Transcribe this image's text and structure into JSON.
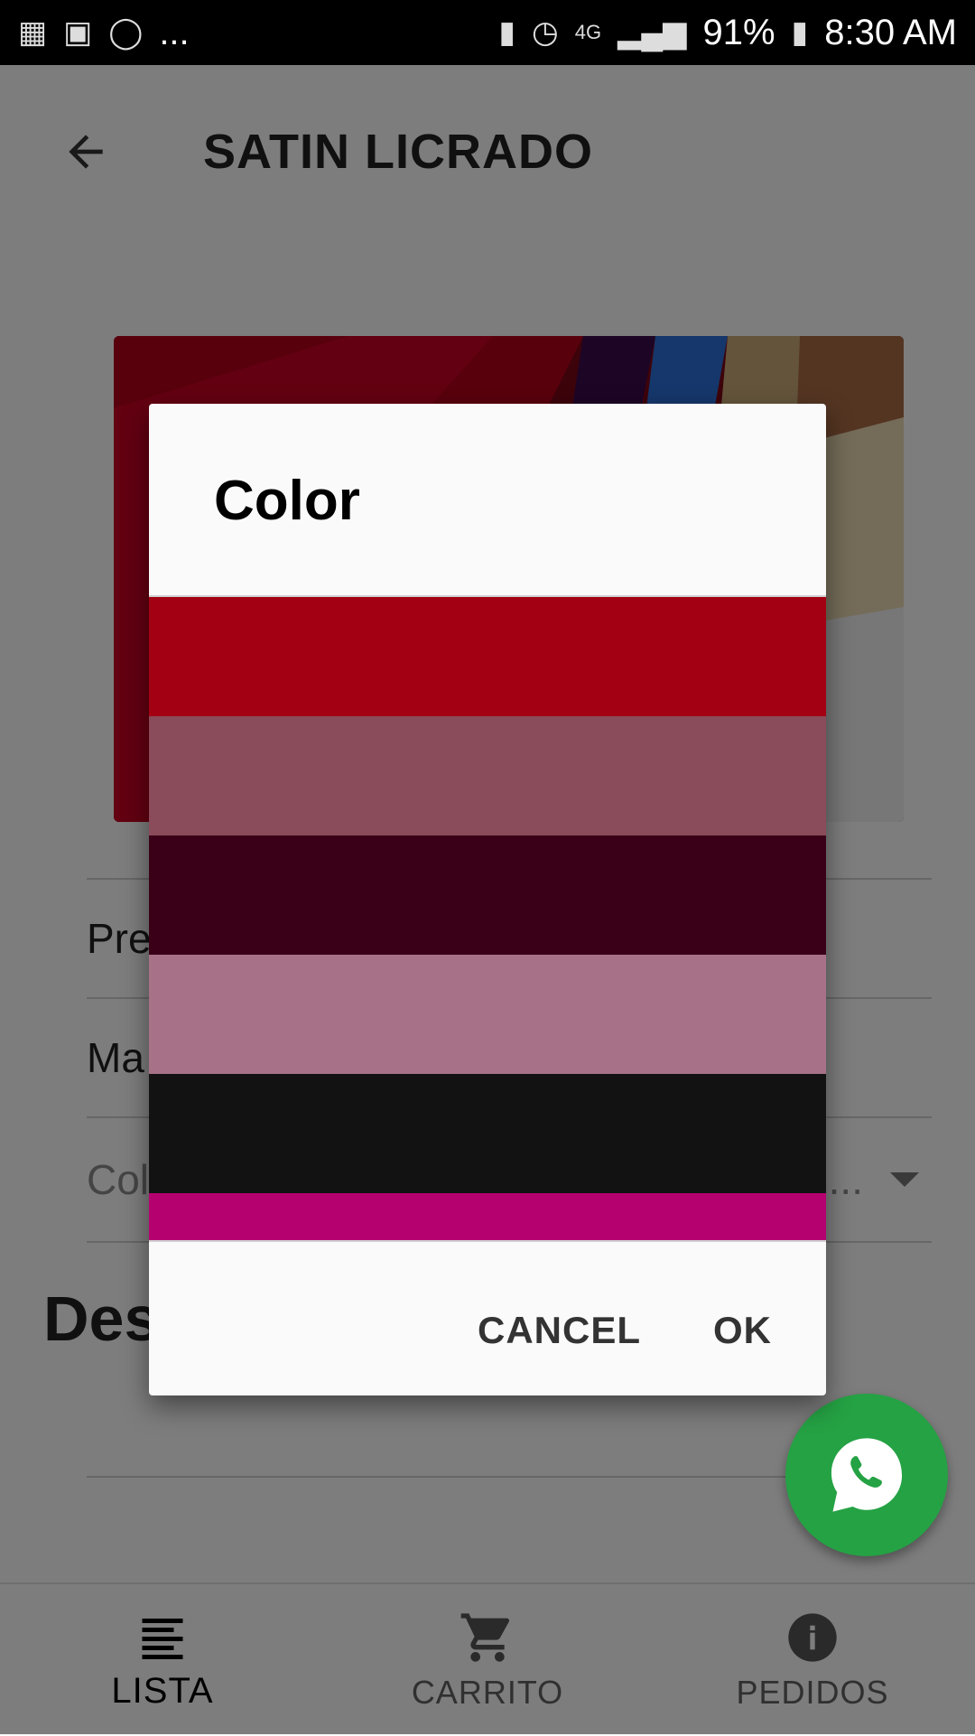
{
  "status_bar": {
    "left_icons": [
      "calendar-icon",
      "image-icon",
      "whatsapp-icon"
    ],
    "overflow": "...",
    "right_icons": [
      "battery-saver-icon",
      "alarm-icon",
      "4g-icon",
      "signal-icon"
    ],
    "battery": "91%",
    "time": "8:30 AM"
  },
  "appbar": {
    "title": "SATIN LICRADO"
  },
  "form": {
    "row1_label": "Pre",
    "row2_label": "Ma",
    "row3_label": "Col",
    "row3_trailing": "..."
  },
  "section": {
    "description_title": "Descripción"
  },
  "bottom_nav": {
    "items": [
      {
        "label": "LISTA",
        "icon": "list-icon"
      },
      {
        "label": "CARRITO",
        "icon": "cart-icon"
      },
      {
        "label": "PEDIDOS",
        "icon": "info-icon"
      }
    ]
  },
  "dialog": {
    "title": "Color",
    "swatches": [
      "#a30013",
      "#8a4b5a",
      "#3a0018",
      "#a77287",
      "#121212",
      "#b5006f"
    ],
    "cancel_label": "CANCEL",
    "ok_label": "OK"
  },
  "colors": {
    "fab": "#25a244"
  }
}
